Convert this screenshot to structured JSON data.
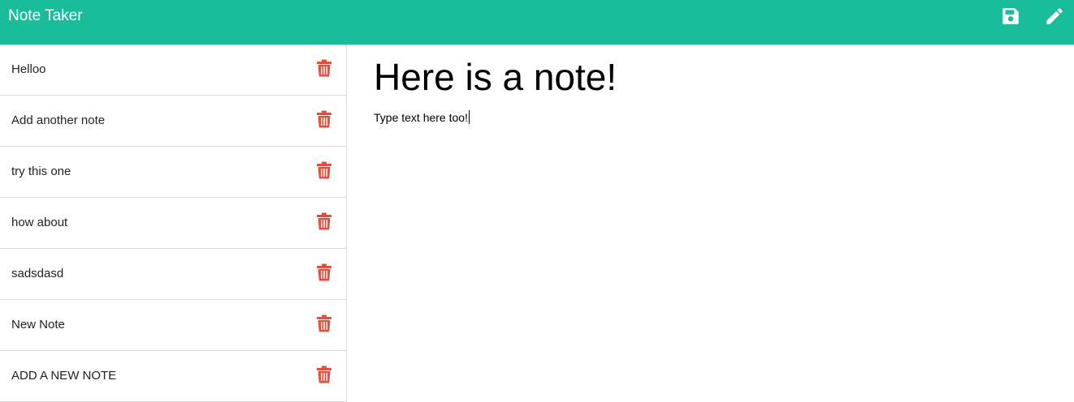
{
  "app": {
    "title": "Note Taker",
    "accent_color": "#19bd9b",
    "delete_color": "#e74c3c"
  },
  "toolbar": {
    "icons": [
      "save-icon",
      "pencil-icon"
    ]
  },
  "sidebar": {
    "items": [
      {
        "label": "Helloo",
        "icon": "trash-icon"
      },
      {
        "label": "Add another note",
        "icon": "trash-icon"
      },
      {
        "label": "try this one",
        "icon": "trash-icon"
      },
      {
        "label": "how about",
        "icon": "trash-icon"
      },
      {
        "label": "sadsdasd",
        "icon": "trash-icon"
      },
      {
        "label": "New Note",
        "icon": "trash-icon"
      },
      {
        "label": "ADD A NEW NOTE",
        "icon": "trash-icon"
      }
    ]
  },
  "editor": {
    "title": "Here is a note!",
    "text": "Type text here too!"
  }
}
